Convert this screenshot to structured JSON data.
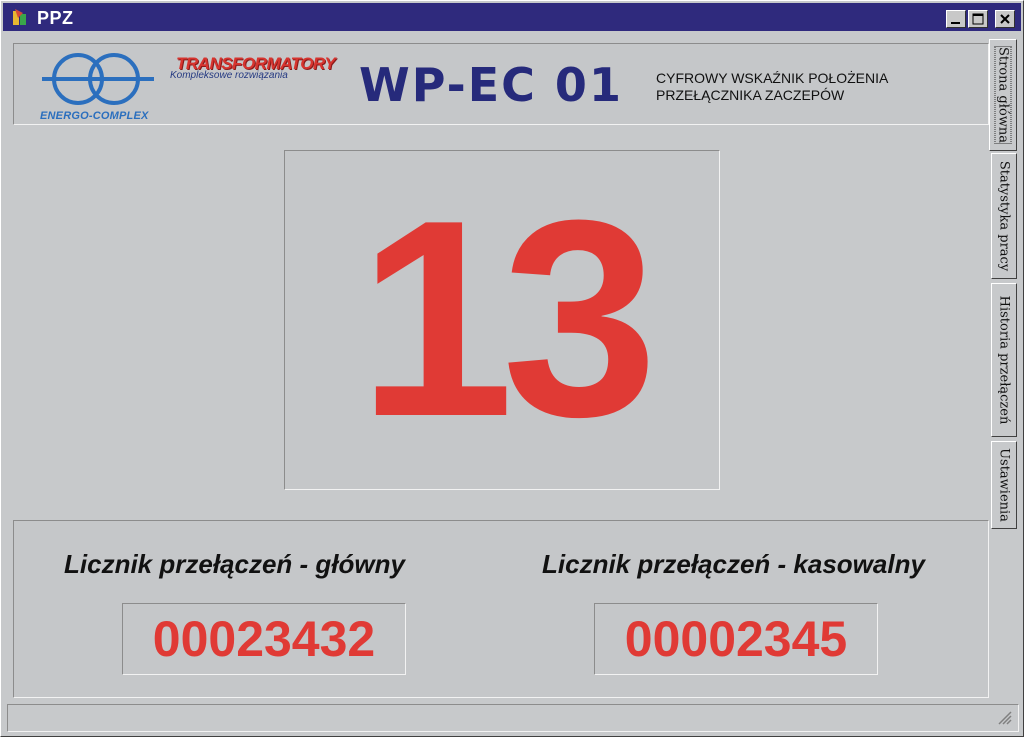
{
  "window": {
    "title": "PPZ",
    "accent_color": "#2f2a7d",
    "controls": [
      "minimize-icon",
      "maximize-icon",
      "close-icon"
    ]
  },
  "header": {
    "logo_company": "ENERGO-COMPLEX",
    "logo_brand": "TRANSFORMATORY",
    "logo_brand_sub": "Kompleksowe rozwiązania",
    "model": "WP-EC 01",
    "description_line1": "CYFROWY WSKAŹNIK POŁOŻENIA",
    "description_line2": "PRZEŁĄCZNIKA ZACZEPÓW"
  },
  "position": {
    "value": "13",
    "color": "#e03a35"
  },
  "counters": {
    "main_label": "Licznik przełączeń - główny",
    "main_value": "00023432",
    "resettable_label": "Licznik przełączeń - kasowalny",
    "resettable_value": "00002345"
  },
  "tabs": [
    {
      "label": "Strona główna",
      "active": true
    },
    {
      "label": "Statystyka pracy",
      "active": false
    },
    {
      "label": "Historia przełączeń",
      "active": false
    },
    {
      "label": "Ustawienia",
      "active": false
    }
  ]
}
